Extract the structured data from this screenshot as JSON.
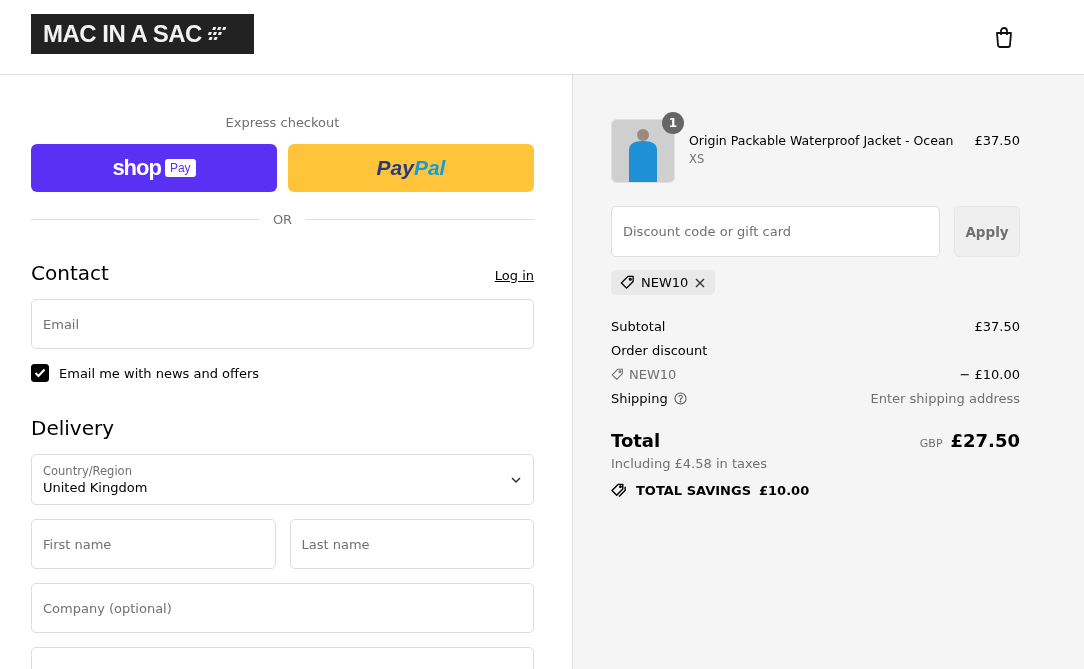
{
  "header": {
    "logo": "MAC IN A SAC"
  },
  "express_checkout": {
    "title": "Express checkout",
    "shop_pay": {
      "word": "shop",
      "badge": "Pay"
    },
    "paypal": {
      "parts": [
        "Pay",
        "Pal"
      ]
    },
    "divider": "OR"
  },
  "contact": {
    "heading": "Contact",
    "login_link": "Log in",
    "email": {
      "placeholder": "Email"
    },
    "newsletter": {
      "label": "Email me with news and offers",
      "checked": true
    }
  },
  "delivery": {
    "heading": "Delivery",
    "country": {
      "label": "Country/Region",
      "value": "United Kingdom"
    },
    "fields": [
      {
        "kind": "pair",
        "items": [
          {
            "placeholder": "First name"
          },
          {
            "placeholder": "Last name"
          }
        ]
      },
      {
        "kind": "single",
        "items": [
          {
            "placeholder": "Company (optional)"
          }
        ]
      },
      {
        "kind": "blank"
      }
    ]
  },
  "summary": {
    "items": [
      {
        "quantity": "1",
        "name": "Origin Packable Waterproof Jacket - Ocean",
        "variant": "XS",
        "price": "£37.50"
      }
    ],
    "discount": {
      "placeholder": "Discount code or gift card",
      "button": "Apply",
      "applied": [
        "NEW10"
      ]
    },
    "lines": [
      {
        "kind": "plain",
        "label": "Subtotal",
        "value": "£37.50"
      },
      {
        "kind": "heading",
        "label": "Order discount"
      },
      {
        "kind": "code",
        "label": "NEW10",
        "value": "− £10.00"
      },
      {
        "kind": "help",
        "label": "Shipping",
        "value": "Enter shipping address"
      }
    ],
    "total": {
      "label": "Total",
      "currency": "GBP",
      "value": "£27.50",
      "taxes": "Including £4.58 in taxes"
    },
    "savings": {
      "label": "TOTAL SAVINGS",
      "value": "£10.00"
    }
  }
}
